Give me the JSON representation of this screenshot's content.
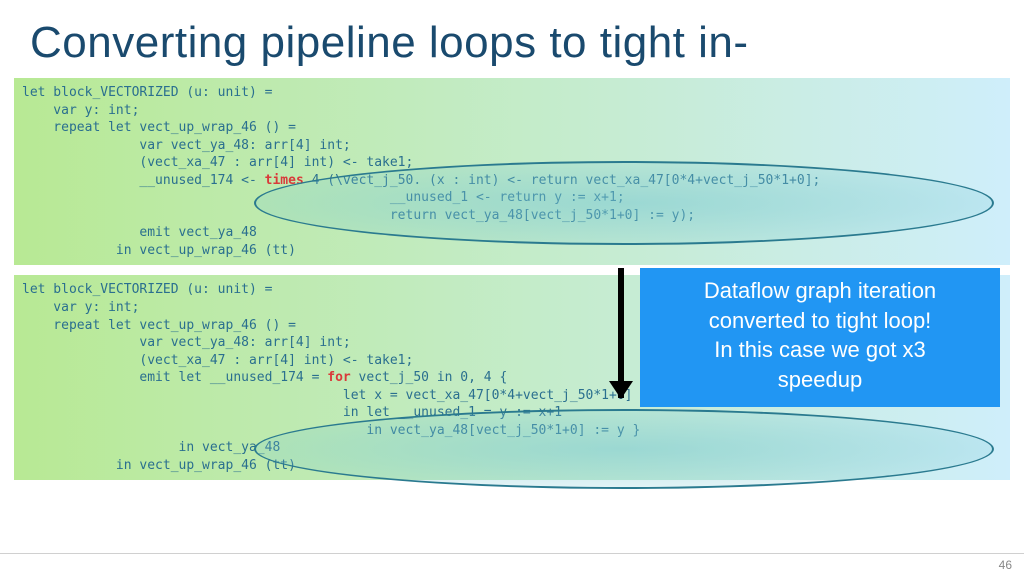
{
  "title": "Converting pipeline loops to tight in-",
  "page_number": "46",
  "code1": {
    "l1": "let block_VECTORIZED (u: unit) =",
    "l2": "    var y: int;",
    "l3": "    repeat let vect_up_wrap_46 () =",
    "l4": "               var vect_ya_48: arr[4] int;",
    "l5": "               (vect_xa_47 : arr[4] int) <- take1;",
    "l6a": "               __unused_174 <- ",
    "l6kw": "times",
    "l6b": " 4 (\\vect_j_50. (x : int) <- return vect_xa_47[0*4+vect_j_50*1+0];",
    "l7": "                                               __unused_1 <- return y := x+1;",
    "l8": "                                               return vect_ya_48[vect_j_50*1+0] := y);",
    "l9": "               emit vect_ya_48",
    "l10": "            in vect_up_wrap_46 (tt)"
  },
  "code2": {
    "l1": "let block_VECTORIZED (u: unit) =",
    "l2": "    var y: int;",
    "l3": "    repeat let vect_up_wrap_46 () =",
    "l4": "               var vect_ya_48: arr[4] int;",
    "l5": "               (vect_xa_47 : arr[4] int) <- take1;",
    "l6a": "               emit let __unused_174 = ",
    "l6kw": "for",
    "l6b": " vect_j_50 in 0, 4 {",
    "l7": "                                         let x = vect_xa_47[0*4+vect_j_50*1+0]",
    "l8": "                                         in let __unused_1 = y := x+1",
    "l9": "                                            in vect_ya_48[vect_j_50*1+0] := y }",
    "l10": "                    in vect_ya_48",
    "l11": "            in vect_up_wrap_46 (tt)"
  },
  "callout": {
    "t1": "Dataflow graph iteration",
    "t2": "converted to tight loop!",
    "t3": "In this case we got x3",
    "t4": "speedup"
  }
}
